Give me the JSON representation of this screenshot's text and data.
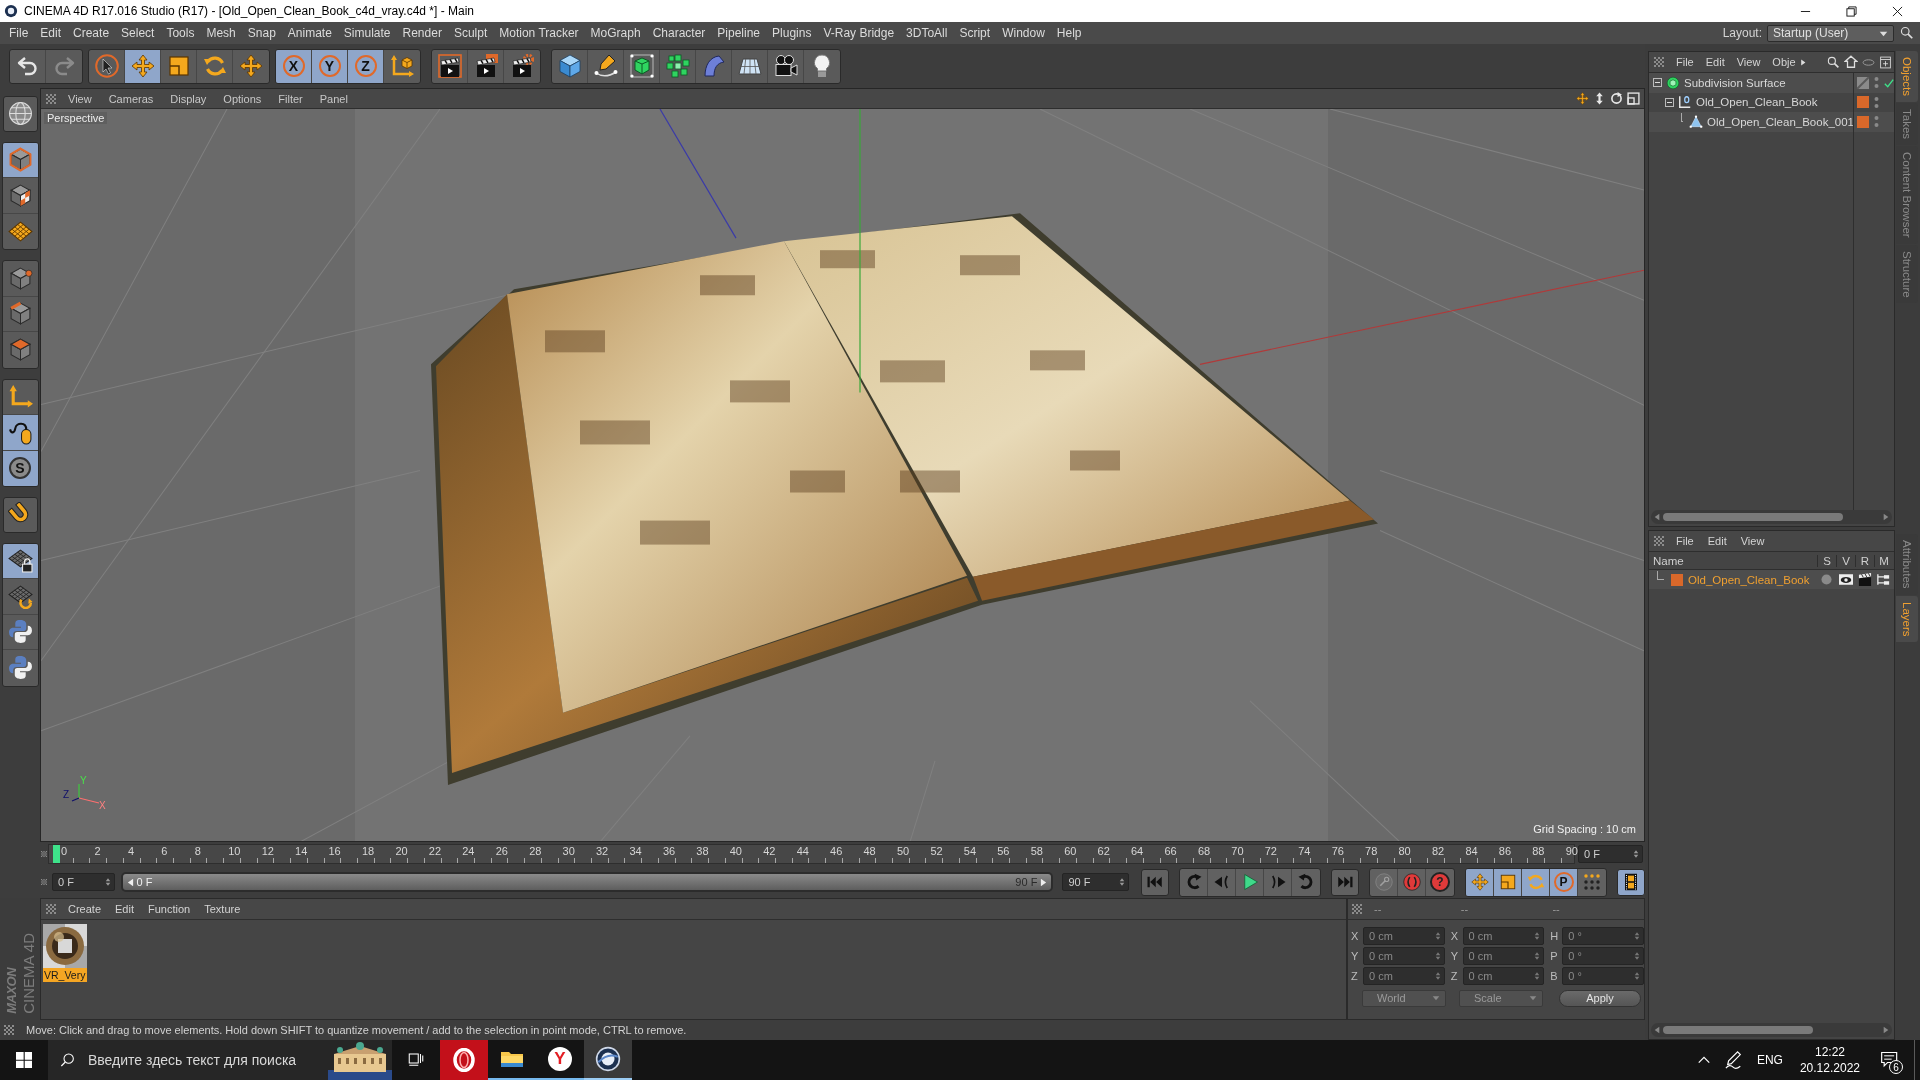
{
  "window": {
    "title": "CINEMA 4D R17.016 Studio (R17) - [Old_Open_Clean_Book_c4d_vray.c4d *] - Main"
  },
  "menu_bar": [
    "File",
    "Edit",
    "Create",
    "Select",
    "Tools",
    "Mesh",
    "Snap",
    "Animate",
    "Simulate",
    "Render",
    "Sculpt",
    "Motion Tracker",
    "MoGraph",
    "Character",
    "Pipeline",
    "Plugins",
    "V-Ray Bridge",
    "3DToAll",
    "Script",
    "Window",
    "Help"
  ],
  "layout": {
    "label": "Layout:",
    "value": "Startup (User)"
  },
  "toolbar": [
    {
      "buttons": [
        {
          "selected": false,
          "disabled": false
        },
        {
          "selected": false,
          "disabled": true
        }
      ]
    },
    {
      "buttons": [
        {
          "selected": false
        },
        {
          "selected": true
        },
        {
          "selected": false
        },
        {
          "selected": false
        },
        {
          "selected": false
        }
      ]
    },
    {
      "buttons": [
        {
          "label": "X",
          "selected": true
        },
        {
          "label": "Y",
          "selected": true
        },
        {
          "label": "Z",
          "selected": true
        },
        {
          "selected": false
        }
      ]
    },
    {
      "buttons": [
        {
          "selected": false
        },
        {
          "selected": false
        },
        {
          "selected": false
        }
      ]
    },
    {
      "buttons": [
        {
          "selected": false
        },
        {
          "selected": false
        },
        {
          "selected": false
        },
        {
          "selected": false
        },
        {
          "selected": false
        },
        {
          "selected": false
        },
        {
          "selected": false
        },
        {
          "selected": false
        }
      ]
    }
  ],
  "left_toolbar": [
    {
      "buttons": [
        {
          "selected": false
        }
      ]
    },
    {
      "buttons": [
        {
          "selected": true
        },
        {
          "selected": false
        },
        {
          "selected": false
        }
      ]
    },
    {
      "buttons": [
        {
          "selected": false
        },
        {
          "selected": false
        },
        {
          "selected": false
        }
      ]
    },
    {
      "buttons": [
        {
          "selected": false
        },
        {
          "selected": true
        },
        {
          "label": "S",
          "selected": true
        }
      ]
    },
    {
      "buttons": [
        {
          "selected": false
        }
      ]
    },
    {
      "buttons": [
        {
          "selected": true
        },
        {
          "selected": false
        },
        {
          "selected": false
        },
        {
          "selected": false
        }
      ]
    }
  ],
  "viewport": {
    "menu": [
      "View",
      "Cameras",
      "Display",
      "Options",
      "Filter",
      "Panel"
    ],
    "camera": "Perspective",
    "grid_spacing": "Grid Spacing : 10 cm",
    "axis_labels": {
      "x": "X",
      "y": "Y",
      "z": "Z"
    }
  },
  "timeline": {
    "frames": [
      "0",
      "2",
      "4",
      "6",
      "8",
      "10",
      "12",
      "14",
      "16",
      "18",
      "20",
      "22",
      "24",
      "26",
      "28",
      "30",
      "32",
      "34",
      "36",
      "38",
      "40",
      "42",
      "44",
      "46",
      "48",
      "50",
      "52",
      "54",
      "56",
      "58",
      "60",
      "62",
      "64",
      "66",
      "68",
      "70",
      "72",
      "74",
      "76",
      "78",
      "80",
      "82",
      "84",
      "86",
      "88",
      "90"
    ],
    "level": 0,
    "current_frame": "0 F"
  },
  "transport": {
    "start_field": "0 F",
    "range": {
      "start": "0 F",
      "end": "90 F",
      "level": 1
    },
    "end_field": "90 F",
    "groups": [
      {
        "buttons": [
          {
            "selected": false
          }
        ]
      },
      {
        "buttons": [
          {
            "selected": false
          },
          {
            "selected": false
          },
          {
            "selected": false
          },
          {
            "selected": false
          },
          {
            "selected": false
          }
        ]
      },
      {
        "buttons": [
          {
            "selected": false
          }
        ]
      },
      {
        "buttons": [
          {
            "selected": false
          },
          {
            "selected": false
          },
          {
            "label": "?",
            "selected": false
          }
        ]
      },
      {
        "buttons": [
          {
            "selected": true
          },
          {
            "selected": true
          },
          {
            "selected": true
          },
          {
            "label": "P",
            "selected": true
          },
          {
            "selected": false
          }
        ]
      },
      {
        "buttons": [
          {
            "selected": true
          }
        ]
      }
    ]
  },
  "materials": {
    "menu": [
      "Create",
      "Edit",
      "Function",
      "Texture"
    ],
    "items": [
      {
        "name": "VR_Very",
        "selected": true
      }
    ]
  },
  "coordinates": {
    "headers": [
      "--",
      "--",
      "--"
    ],
    "rows": [
      {
        "fields": [
          {
            "axis": "X",
            "value": "0 cm"
          },
          {
            "axis": "X",
            "value": "0 cm"
          },
          {
            "axis": "H",
            "value": "0 °"
          }
        ]
      },
      {
        "fields": [
          {
            "axis": "Y",
            "value": "0 cm"
          },
          {
            "axis": "Y",
            "value": "0 cm"
          },
          {
            "axis": "P",
            "value": "0 °"
          }
        ]
      },
      {
        "fields": [
          {
            "axis": "Z",
            "value": "0 cm"
          },
          {
            "axis": "Z",
            "value": "0 cm"
          },
          {
            "axis": "B",
            "value": "0 °"
          }
        ]
      }
    ],
    "mode": "World",
    "transform": "Scale",
    "apply": "Apply"
  },
  "logo": {
    "brand": "MAXON",
    "product": "CINEMA 4D"
  },
  "status_bar": "Move: Click and drag to move elements. Hold down SHIFT to quantize movement / add to the selection in point mode, CTRL to remove.",
  "object_manager": {
    "menu": [
      "File",
      "Edit",
      "View",
      "Obje"
    ],
    "objects": [
      {
        "name": "Subdivision Surface",
        "kind": "subdivision",
        "expanded": true,
        "enabled": true,
        "children": [
          {
            "name": "Old_Open_Clean_Book",
            "kind": "null",
            "expanded": true,
            "color": "#d9682a",
            "children": [
              {
                "name": "Old_Open_Clean_Book_001",
                "kind": "polygon",
                "color": "#d9682a"
              }
            ]
          }
        ]
      }
    ]
  },
  "layer_manager": {
    "menu": [
      "File",
      "Edit",
      "View"
    ],
    "columns": [
      "Name",
      "S",
      "V",
      "R",
      "M"
    ],
    "layers": [
      {
        "name": "Old_Open_Clean_Book",
        "color": "#d9682a",
        "solo": false,
        "visible": true,
        "render": true,
        "manager": true
      }
    ]
  },
  "side_tabs": [
    {
      "label": "Objects",
      "selected": true
    },
    {
      "label": "Takes",
      "selected": false
    },
    {
      "label": "Content Browser",
      "selected": false
    },
    {
      "label": "Structure",
      "selected": false
    }
  ],
  "side_tabs_lower": [
    {
      "label": "Attributes",
      "selected": false
    },
    {
      "label": "Layers",
      "selected": true
    }
  ],
  "taskbar": {
    "search_placeholder": "Введите здесь текст для поиска",
    "apps": [
      {
        "kind": "ring",
        "highlighted": true,
        "running": false,
        "active": false
      },
      {
        "kind": "folder",
        "highlighted": false,
        "running": true,
        "active": false
      },
      {
        "kind": "letter",
        "label": "Y",
        "highlighted": false,
        "running": true,
        "active": false
      },
      {
        "kind": "sphere",
        "highlighted": false,
        "running": true,
        "active": true
      }
    ],
    "language": "ENG",
    "time": "12:22",
    "date": "20.12.2022",
    "notifications": "6"
  }
}
